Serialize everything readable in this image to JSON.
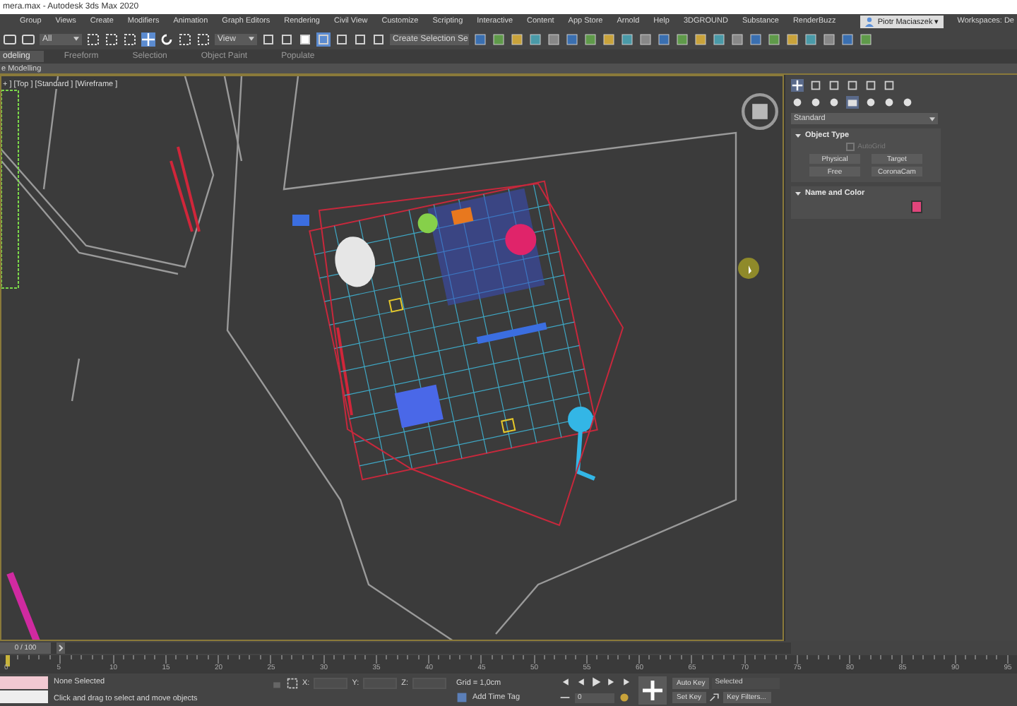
{
  "window": {
    "title": "mera.max - Autodesk 3ds Max 2020"
  },
  "menu": [
    "Group",
    "Views",
    "Create",
    "Modifiers",
    "Animation",
    "Graph Editors",
    "Rendering",
    "Civil View",
    "Customize",
    "Scripting",
    "Interactive",
    "Content",
    "App Store",
    "Arnold",
    "Help",
    "3DGROUND",
    "Substance",
    "RenderBuzz"
  ],
  "user": {
    "name": "Piotr Maciaszek ▾"
  },
  "workspaces": {
    "label": "Workspaces: De"
  },
  "toolbar": {
    "filter": "All",
    "reference": "View",
    "selection_set": "Create Selection Se"
  },
  "ribbon": {
    "tabs": [
      {
        "label": "odeling",
        "selected": true
      },
      {
        "label": "Freeform",
        "selected": false
      },
      {
        "label": "Selection",
        "selected": false
      },
      {
        "label": "Object Paint",
        "selected": false
      },
      {
        "label": "Populate",
        "selected": false
      }
    ],
    "panel": "e Modelling"
  },
  "viewport": {
    "label": "+ ] [Top ] [Standard ] [Wireframe ]"
  },
  "command_panel": {
    "category": "Standard",
    "rollouts": [
      {
        "title": "Object Type",
        "expanded": true,
        "autogrid": {
          "label": "AutoGrid",
          "checked": false,
          "disabled": true
        },
        "buttons": [
          "Physical",
          "Target",
          "Free",
          "CoronaCam"
        ]
      },
      {
        "title": "Name and Color",
        "expanded": true,
        "color": "#e0457b"
      }
    ]
  },
  "time_slider": {
    "label": "0 / 100",
    "level": 0
  },
  "ruler": [
    "0",
    "5",
    "10",
    "15",
    "20",
    "25",
    "30",
    "35",
    "40",
    "45",
    "50",
    "55",
    "60",
    "65",
    "70",
    "75",
    "80",
    "85",
    "90",
    "95"
  ],
  "status": {
    "selection": "None Selected",
    "prompt": "Click and drag to select and move objects",
    "x_label": "X:",
    "y_label": "Y:",
    "z_label": "Z:",
    "grid": "Grid = 1,0cm",
    "time_tag": "Add Time Tag",
    "frame": "0",
    "auto_key": "Auto Key",
    "set_key": "Set Key",
    "key_mode": "Selected",
    "key_filters": "Key Filters..."
  }
}
